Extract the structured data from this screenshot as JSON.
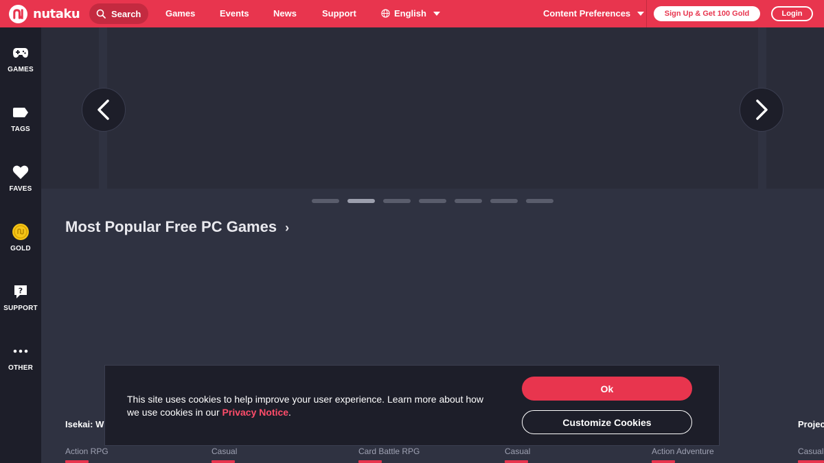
{
  "brand": {
    "name": "nutaku",
    "accent": "#e8354e",
    "sidebar_bg": "#1d1e29",
    "page_bg": "#2f3241"
  },
  "topnav": {
    "search_label": "Search",
    "links": [
      "Games",
      "Events",
      "News",
      "Support"
    ],
    "language": "English",
    "content_preferences": "Content Preferences",
    "signup_label": "Sign Up & Get 100 Gold",
    "login_label": "Login"
  },
  "sidebar": {
    "items": [
      {
        "label": "GAMES",
        "icon": "gamepad-icon"
      },
      {
        "label": "TAGS",
        "icon": "tag-icon"
      },
      {
        "label": "FAVES",
        "icon": "heart-icon"
      },
      {
        "label": "GOLD",
        "icon": "gold-coin-icon"
      },
      {
        "label": "SUPPORT",
        "icon": "help-icon"
      },
      {
        "label": "OTHER",
        "icon": "more-icon"
      }
    ]
  },
  "carousel": {
    "slide_count": 7,
    "active_index": 1
  },
  "section": {
    "title": "Most Popular Free PC Games"
  },
  "games": [
    {
      "title": "Isekai: W",
      "tag": "Action RPG"
    },
    {
      "title": "",
      "tag": "Casual"
    },
    {
      "title": "",
      "tag": "Card Battle RPG"
    },
    {
      "title": "",
      "tag": "Casual"
    },
    {
      "title": "",
      "tag": "Action Adventure"
    },
    {
      "title": "Projec",
      "tag": "Casual"
    }
  ],
  "cookie": {
    "text": "This site uses cookies to help improve your user experience. Learn more about how we use cookies in our ",
    "link": "Privacy Notice",
    "suffix": ".",
    "ok_label": "Ok",
    "customize_label": "Customize Cookies"
  }
}
